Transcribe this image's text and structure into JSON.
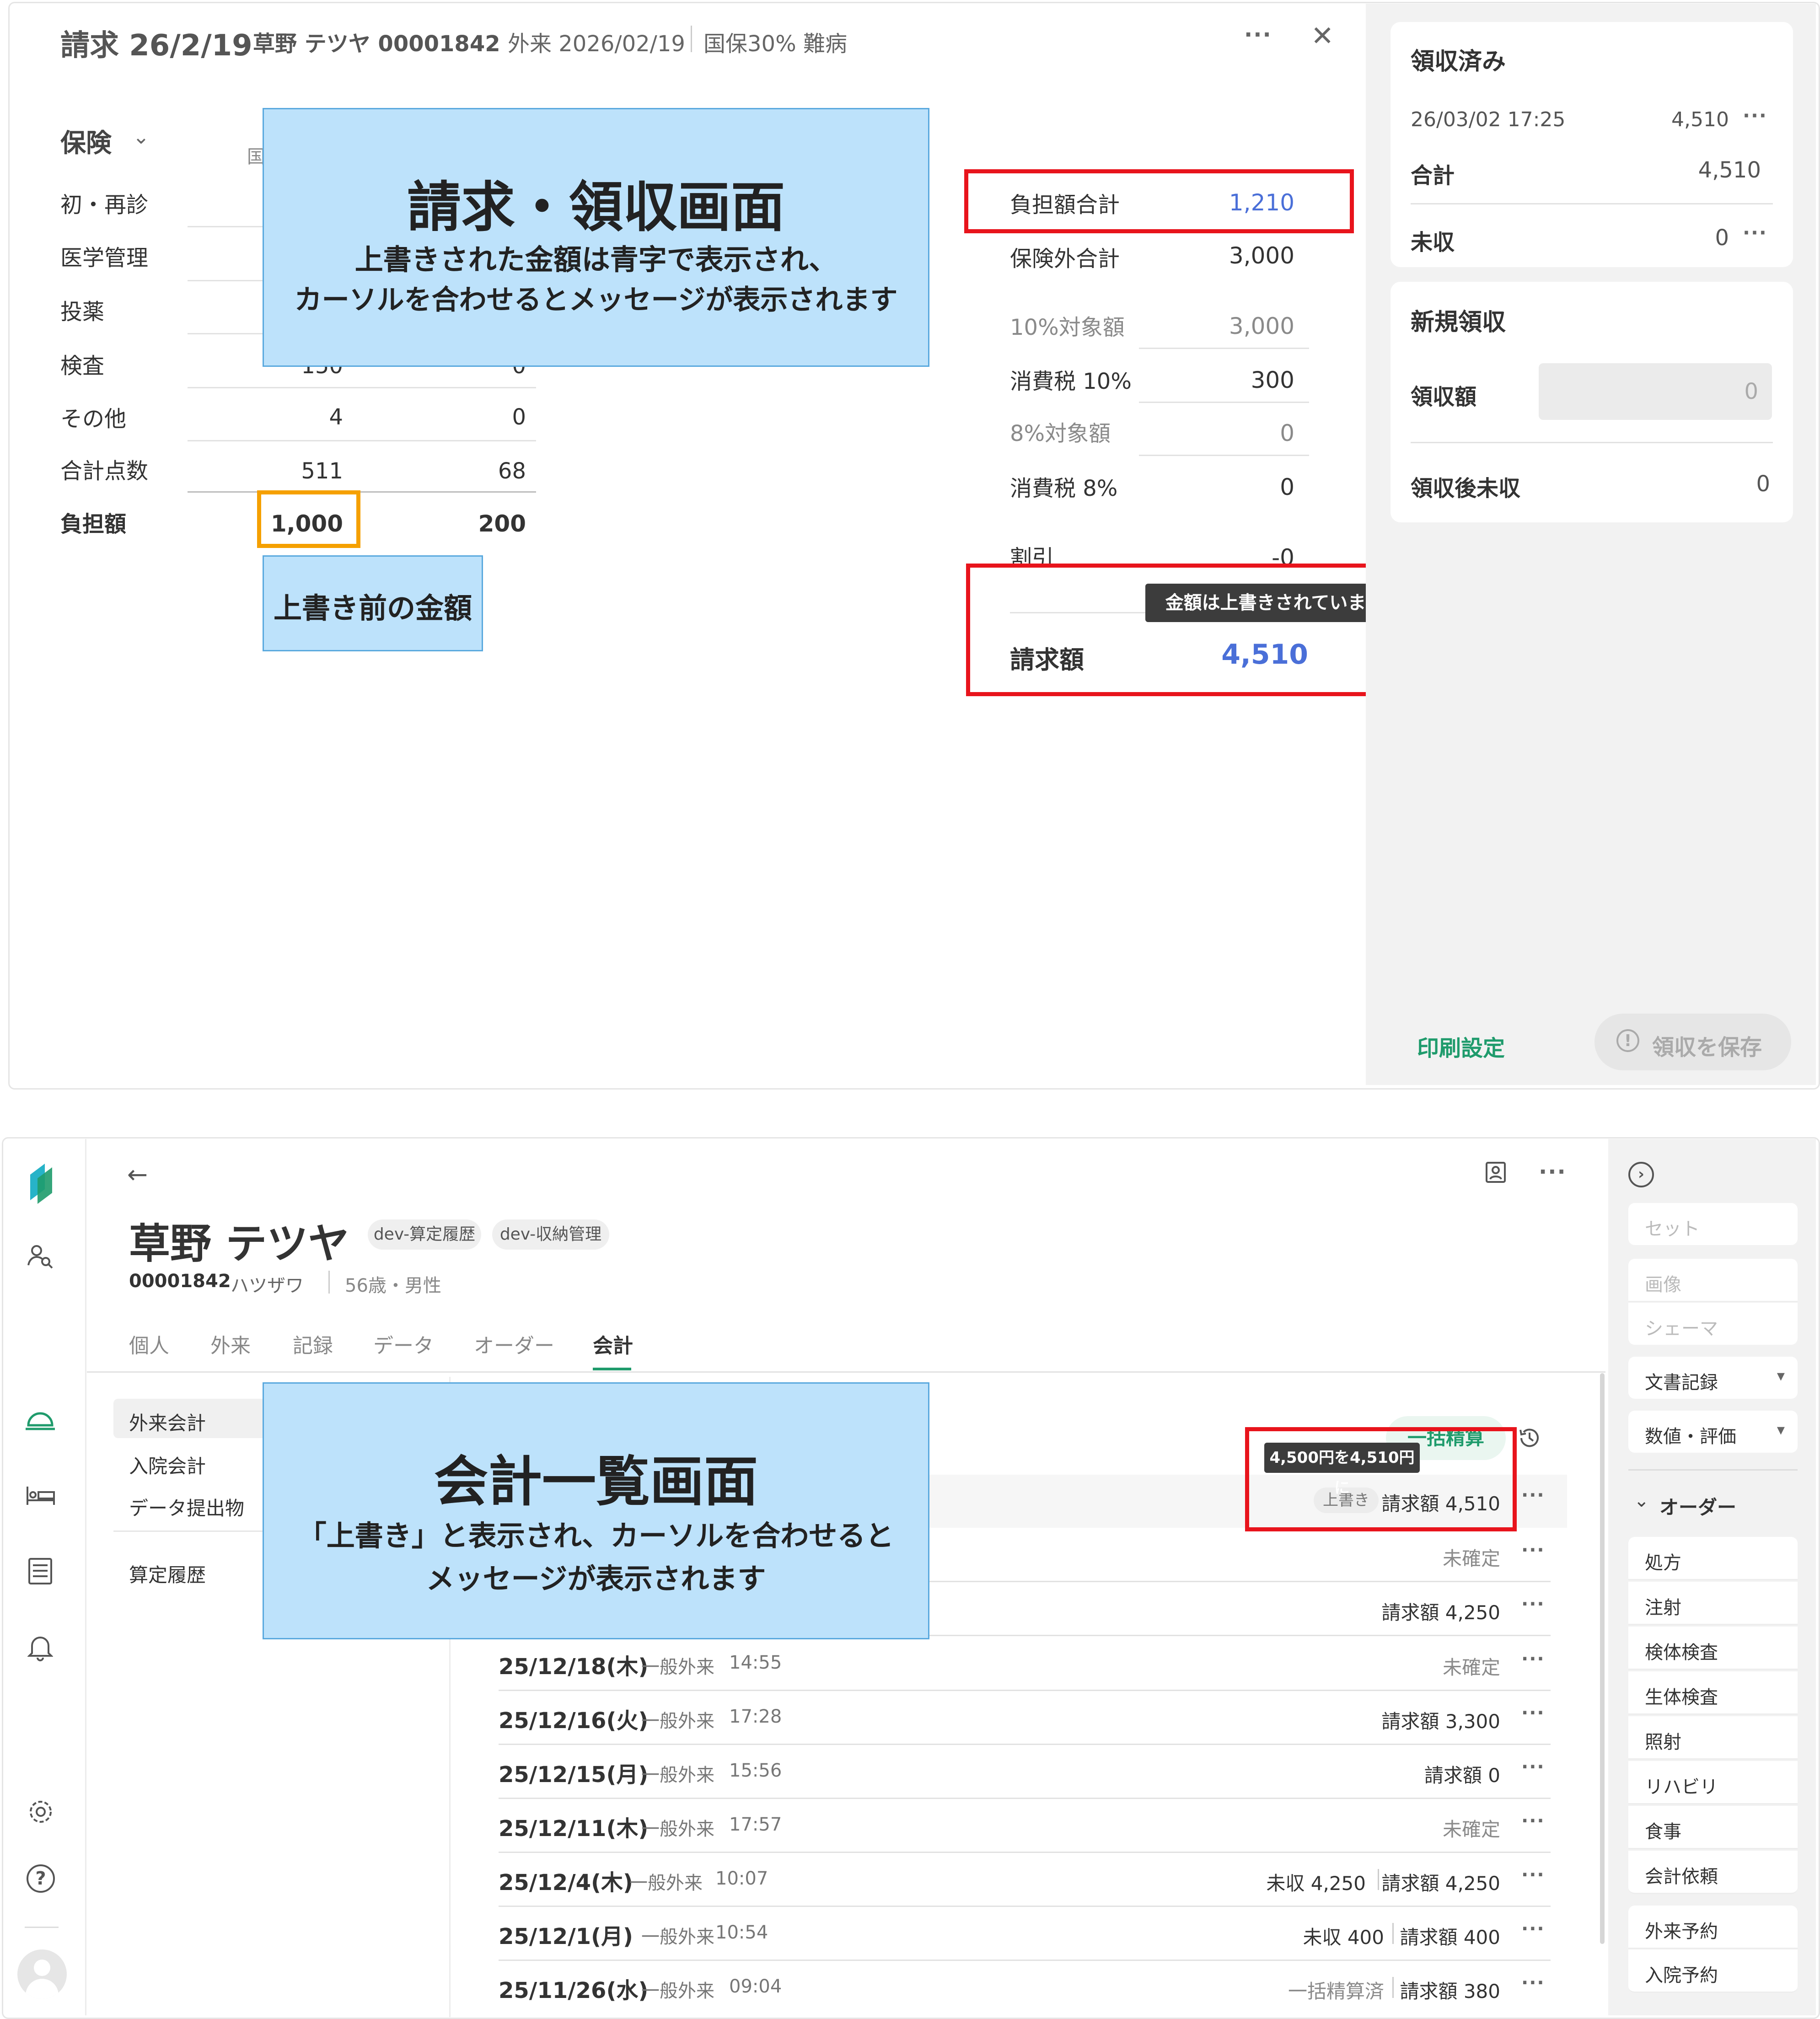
{
  "top": {
    "header": {
      "title": "請求 26/2/19",
      "patient": "草野 テツヤ 00001842",
      "visit": "外来 2026/02/19",
      "insurance": "国保30% 難病",
      "more": "···",
      "close": "✕"
    },
    "insurance_section": {
      "title": "保険",
      "partial_col": "国",
      "rows": [
        {
          "label": "初・再診"
        },
        {
          "label": "医学管理"
        },
        {
          "label": "投薬"
        },
        {
          "label": "検査",
          "v1": "150",
          "v2": "0"
        },
        {
          "label": "その他",
          "v1": "4",
          "v2": "0"
        },
        {
          "label": "合計点数",
          "v1": "511",
          "v2": "68"
        },
        {
          "label": "負担額",
          "v1": "1,000",
          "v2": "200"
        }
      ]
    },
    "summary": {
      "burden_total_label": "負担額合計",
      "burden_total_value": "1,210",
      "noninsured_label": "保険外合計",
      "noninsured_value": "3,000",
      "tax10_base_label": "10%対象額",
      "tax10_base_value": "3,000",
      "tax10_label": "消費税 10%",
      "tax10_value": "300",
      "tax8_base_label": "8%対象額",
      "tax8_base_value": "0",
      "tax8_label": "消費税 8%",
      "tax8_value": "0",
      "discount_label": "割引",
      "discount_value": "-0",
      "tooltip": "金額は上書きされています",
      "billed_label": "請求額",
      "billed_value": "4,510"
    },
    "right_panel": {
      "received_title": "領収済み",
      "received_datetime": "26/03/02 17:25",
      "received_amount": "4,510",
      "more": "···",
      "total_label": "合計",
      "total_value": "4,510",
      "unpaid_label": "未収",
      "unpaid_value": "0",
      "new_title": "新規領収",
      "receipt_label": "領収額",
      "receipt_placeholder": "0",
      "after_label": "領収後未収",
      "after_value": "0",
      "print_settings": "印刷設定",
      "save_button": "領収を保存"
    },
    "annotation": {
      "title": "請求・領収画面",
      "line1": "上書きされた金額は青字で表示され、",
      "line2": "カーソルを合わせるとメッセージが表示されます",
      "pre_override": "上書き前の金額"
    }
  },
  "bottom": {
    "patient": {
      "name": "草野 テツヤ",
      "tag1": "dev-算定履歴",
      "tag2": "dev-収納管理",
      "id": "00001842",
      "kana": "ハツザワ",
      "age_sex": "56歳・男性"
    },
    "tabs": [
      "個人",
      "外来",
      "記録",
      "データ",
      "オーダー",
      "会計"
    ],
    "left_menu": [
      "外来会計",
      "入院会計",
      "データ提出物",
      "算定履歴"
    ],
    "bulk_button": "一括精算",
    "tooltip": "4,500円を4,510円に",
    "override_badge": "上書き",
    "rows": [
      {
        "right": "請求額 4,510"
      },
      {
        "right": "未確定"
      },
      {
        "right": "請求額 4,250"
      },
      {
        "date": "25/12/18(木)",
        "type": "一般外来",
        "time": "14:55",
        "right": "未確定"
      },
      {
        "date": "25/12/16(火)",
        "type": "一般外来",
        "time": "17:28",
        "right": "請求額 3,300"
      },
      {
        "date": "25/12/15(月)",
        "type": "一般外来",
        "time": "15:56",
        "right": "請求額 0"
      },
      {
        "date": "25/12/11(木)",
        "type": "一般外来",
        "time": "17:57",
        "right": "未確定"
      },
      {
        "date": "25/12/4(木)",
        "type": "一般外来",
        "time": "10:07",
        "extra": "未収 4,250",
        "right": "請求額 4,250"
      },
      {
        "date": "25/12/1(月)",
        "type": "一般外来",
        "time": "10:54",
        "extra": "未収 400",
        "right": "請求額 400"
      },
      {
        "date": "25/11/26(水)",
        "type": "一般外来",
        "time": "09:04",
        "extra": "一括精算済",
        "right": "請求額 380"
      }
    ],
    "right_panel": {
      "set_placeholder": "セット",
      "image": "画像",
      "schema": "シェーマ",
      "doc_record": "文書記録",
      "numeric_eval": "数値・評価",
      "order_header": "オーダー",
      "orders": [
        "処方",
        "注射",
        "検体検査",
        "生体検査",
        "照射",
        "リハビリ",
        "食事",
        "会計依頼"
      ],
      "reserve_out": "外来予約",
      "reserve_in": "入院予約"
    },
    "annotation": {
      "title": "会計一覧画面",
      "line1": "「上書き」と表示され、カーソルを合わせると",
      "line2": "メッセージが表示されます"
    }
  },
  "colors": {
    "accent_blue": "#4a6fd8",
    "accent_green": "#1f9b6c",
    "highlight_red": "#e8141c",
    "highlight_orange": "#f5a000",
    "note_blue": "#bde2fb"
  }
}
